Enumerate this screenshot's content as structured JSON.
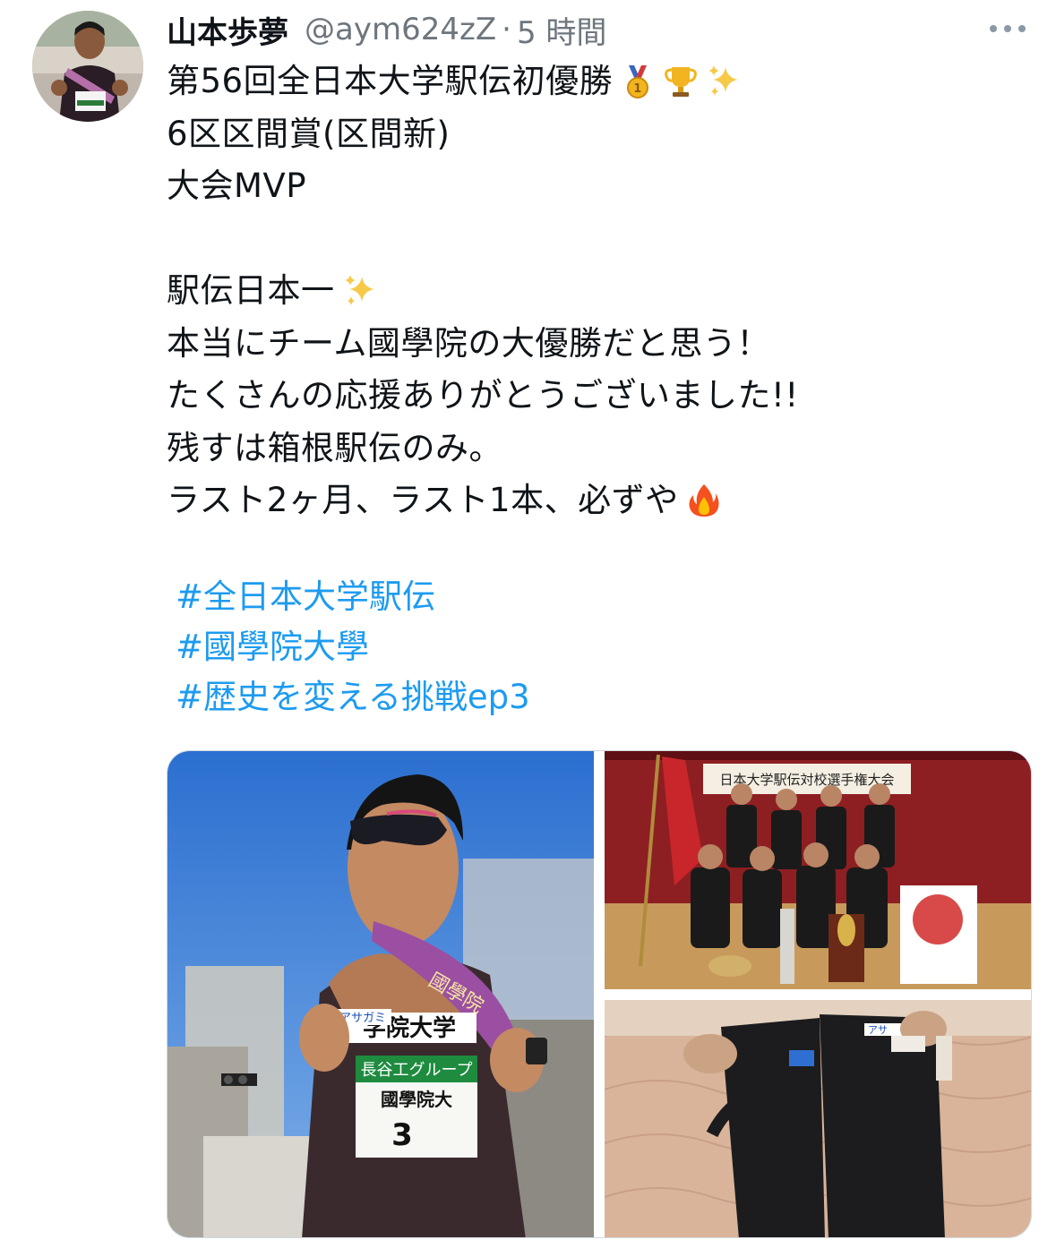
{
  "tweet": {
    "author": {
      "display_name": "山本歩夢",
      "handle": "@aym624zZ",
      "separator": "·",
      "time": "5 時間",
      "avatar_icon": "runner-avatar"
    },
    "lines": [
      {
        "text": "第56回全日本大学駅伝初優勝",
        "emojis": [
          "gold-medal-icon",
          "trophy-icon",
          "sparkles-icon"
        ]
      },
      {
        "text": "6区区間賞(区間新)",
        "emojis": []
      },
      {
        "text": "大会MVP",
        "emojis": []
      },
      {
        "text": "",
        "emojis": []
      },
      {
        "text": "駅伝日本一",
        "emojis": [
          "sparkles-icon"
        ]
      },
      {
        "text": "本当にチーム國學院の大優勝だと思う！",
        "emojis": []
      },
      {
        "text": "たくさんの応援ありがとうございました!!",
        "emojis": []
      },
      {
        "text": "残すは箱根駅伝のみ。",
        "emojis": []
      },
      {
        "text": "ラスト2ヶ月、ラスト1本、必ずや",
        "emojis": [
          "fire-icon"
        ]
      }
    ],
    "hashtags": [
      "#全日本大学駅伝",
      "#國學院大學",
      "#歴史を変える挑戦ep3"
    ],
    "media": {
      "main_photo": {
        "sponsor": "アサガミ",
        "bib_top": "学院大学",
        "bib_sponsor": "長谷工グループ",
        "bib_team": "國學院大",
        "bib_number": "3",
        "sash": "國學院"
      },
      "team_photo": {
        "banner": "日本大学駅伝対校選手権大会"
      },
      "duo_photo": {
        "sponsor": "アサ"
      }
    }
  }
}
